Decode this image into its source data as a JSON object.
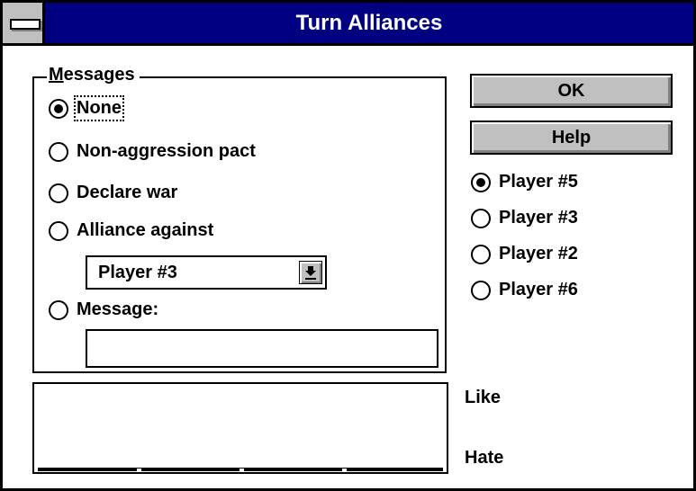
{
  "window": {
    "title": "Turn Alliances",
    "system_menu_icon": "minus-bar-icon"
  },
  "messages": {
    "group_label_accel": "M",
    "group_label_rest": "essages",
    "options": [
      {
        "label": "None",
        "checked": true
      },
      {
        "label": "Non-aggression pact",
        "checked": false
      },
      {
        "label": "Declare war",
        "checked": false
      },
      {
        "label": "Alliance against",
        "checked": false
      },
      {
        "label": "Message:",
        "checked": false
      }
    ],
    "alliance_target": {
      "selected": "Player #3"
    },
    "message_text": ""
  },
  "buttons": {
    "ok": "OK",
    "help": "Help"
  },
  "players": [
    {
      "label": "Player #5",
      "checked": true
    },
    {
      "label": "Player #3",
      "checked": false
    },
    {
      "label": "Player #2",
      "checked": false
    },
    {
      "label": "Player #6",
      "checked": false
    }
  ],
  "attitude": {
    "like_label": "Like",
    "hate_label": "Hate"
  }
}
